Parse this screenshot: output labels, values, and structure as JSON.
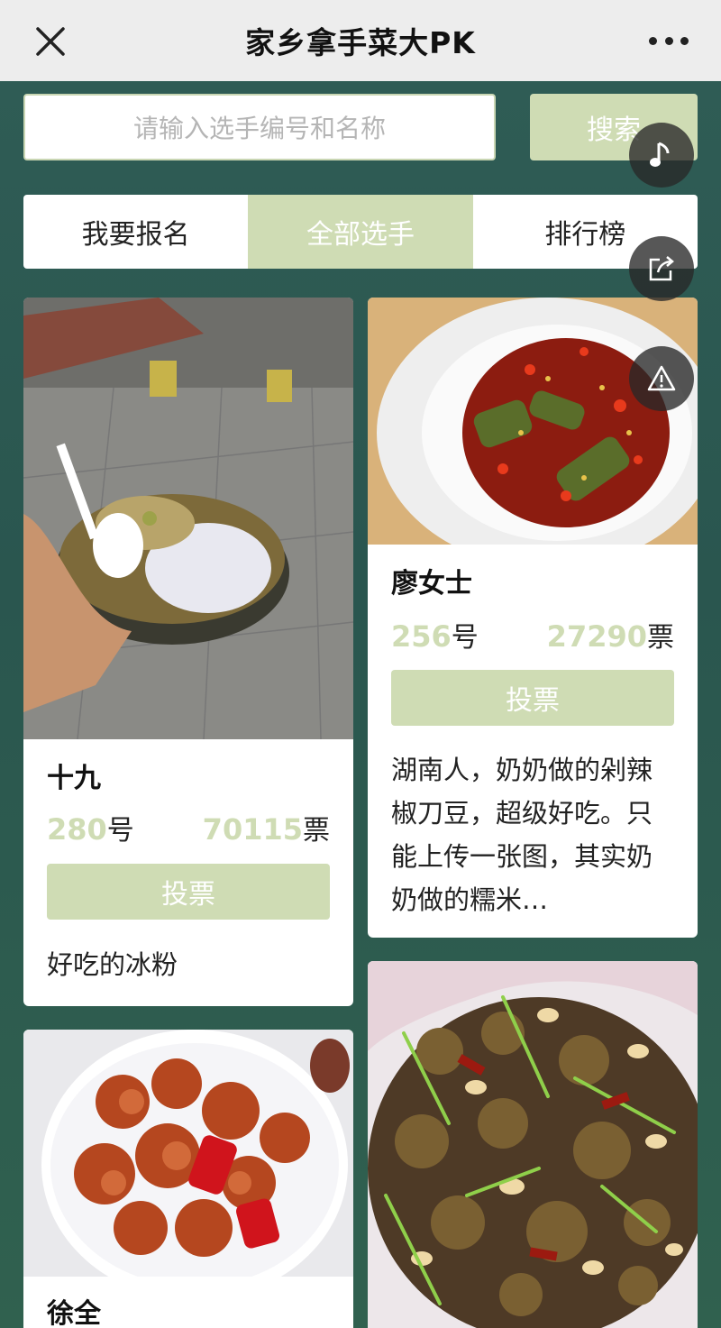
{
  "header": {
    "title": "家乡拿手菜大PK"
  },
  "search": {
    "placeholder": "请输入选手编号和名称",
    "button_label": "搜索"
  },
  "tabs": [
    {
      "label": "我要报名"
    },
    {
      "label": "全部选手"
    },
    {
      "label": "排行榜"
    }
  ],
  "contestants": [
    {
      "name": "十九",
      "number": "280",
      "number_unit": "号",
      "votes": "70115",
      "votes_unit": "票",
      "vote_label": "投票",
      "description": "好吃的冰粉"
    },
    {
      "name": "廖女士",
      "number": "256",
      "number_unit": "号",
      "votes": "27290",
      "votes_unit": "票",
      "vote_label": "投票",
      "description": "湖南人，奶奶做的剁辣椒刀豆，超级好吃。只能上传一张图，其实奶奶做的糯米…"
    },
    {
      "name": "徐全"
    }
  ],
  "icons": {
    "close": "close-icon",
    "more": "more-icon",
    "music": "music-note-icon",
    "share": "share-icon",
    "report": "warning-icon"
  },
  "colors": {
    "accent": "#cfdcb4",
    "background": "#2c5a52",
    "topbar": "#ededed"
  }
}
